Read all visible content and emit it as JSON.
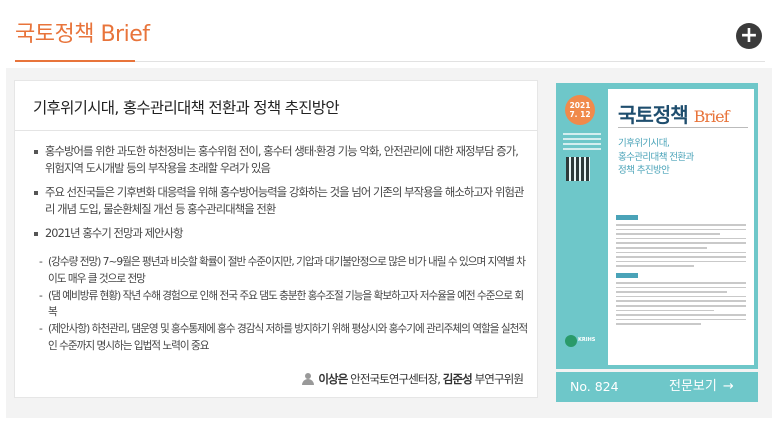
{
  "header": {
    "brand_ko": "국토정책",
    "brand_en": "Brief",
    "more_icon": "plus-circle-icon",
    "accent_color": "#e8743b"
  },
  "article": {
    "title": "기후위기시대, 홍수관리대책 전환과 정책 추진방안",
    "bullets": [
      "홍수방어를 위한 과도한 하천정비는 홍수위험 전이, 홍수터 생태·환경 기능 악화, 안전관리에 대한 재정부담 증가, 위험지역 도시개발 등의 부작용을 초래할 우려가 있음",
      "주요 선진국들은 기후변화 대응력을 위해 홍수방어능력을 강화하는 것을 넘어 기존의 부작용을 해소하고자 위험관리 개념 도입, 물순환체질 개선 등 홍수관리대책을 전환",
      "2021년 홍수기 전망과 제안사항"
    ],
    "sub_items": [
      "(강수량 전망) 7~9월은 평년과 비슷할 확률이 절반 수준이지만, 기압과 대기불안정으로 많은 비가 내릴 수 있으며 지역별 차이도 매우 클 것으로 전망",
      "(댐 예비방류 현황) 작년 수해 경험으로 인해 전국 주요 댐도 충분한 홍수조절 기능을 확보하고자 저수율을 예전 수준으로 회복",
      "(제안사항) 하천관리, 댐운영 및 홍수통제에 홍수 경감식 저하를 방지하기 위해 평상시와 홍수기에 관리주체의 역할을 실천적인 수준까지 명시하는 입법적 노력이 중요"
    ],
    "author_icon": "person-icon",
    "author_primary": "이상은",
    "author_primary_role": "안전국토연구센터장,",
    "author_secondary": "김준성",
    "author_secondary_role": "부연구위원"
  },
  "cover": {
    "year": "2021",
    "date": "7. 12",
    "brand_ko": "국토정책",
    "brand_en": "Brief",
    "title_lines": [
      "기후위기시대,",
      "홍수관리대책 전환과",
      "정책 추진방안"
    ],
    "logo_text": "KRIHS",
    "cover_color": "#6ec7c9"
  },
  "footer": {
    "issue_label": "No. 824",
    "view_label": "전문보기",
    "arrow_icon": "arrow-right-icon"
  }
}
